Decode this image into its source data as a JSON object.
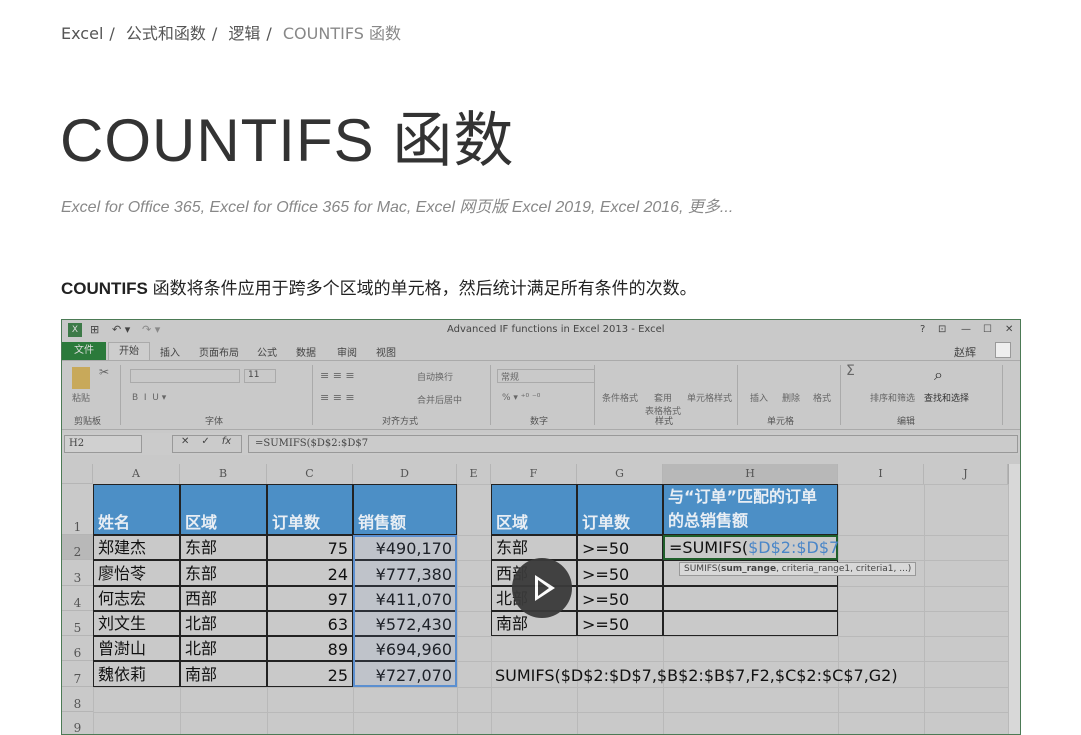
{
  "breadcrumb": [
    "Excel",
    "公式和函数",
    "逻辑",
    "COUNTIFS 函数"
  ],
  "breadcrumb_sep": "/",
  "title": "COUNTIFS 函数",
  "applies_to": "Excel for Office 365, Excel for Office 365 for Mac, Excel 网页版 Excel 2019, Excel 2016, 更多...",
  "intro": {
    "bold": "COUNTIFS",
    "text": " 函数将条件应用于跨多个区域的单元格，然后统计满足所有条件的次数。"
  },
  "excel": {
    "window_title": "Advanced IF functions in Excel 2013 - Excel",
    "window_buttons": [
      "?",
      "⊡",
      "—",
      "☐",
      "✕"
    ],
    "qat": [
      "⊞",
      "↶ ▾",
      "↷ ▾",
      "₹"
    ],
    "user": "赵辉",
    "tabs": [
      "文件",
      "开始",
      "插入",
      "页面布局",
      "公式",
      "数据",
      "审阅",
      "视图"
    ],
    "ribbon": {
      "groups": [
        "剪贴板",
        "字体",
        "对齐方式",
        "数字",
        "样式",
        "单元格",
        "编辑"
      ],
      "paste": "粘贴",
      "font_size": "11",
      "wrap_text": "自动换行",
      "merge_center": "合并后居中",
      "number_format": "常规",
      "styles": [
        "条件格式",
        "套用\n表格格式",
        "单元格样式"
      ],
      "cells": [
        "插入",
        "删除",
        "格式"
      ],
      "editing": [
        "排序和筛选",
        "查找和选择"
      ]
    },
    "name_box": "H2",
    "formula": "=SUMIFS($D$2:$D$7",
    "columns": [
      "A",
      "B",
      "C",
      "D",
      "E",
      "F",
      "G",
      "H",
      "I",
      "J"
    ],
    "rows": [
      "1",
      "2",
      "3",
      "4",
      "5",
      "6",
      "7",
      "8",
      "9"
    ],
    "table1": {
      "headers": [
        "姓名",
        "区域",
        "订单数",
        "销售额"
      ],
      "rows": [
        [
          "郑建杰",
          "东部",
          "75",
          "¥490,170"
        ],
        [
          "廖怡苓",
          "东部",
          "24",
          "¥777,380"
        ],
        [
          "何志宏",
          "西部",
          "97",
          "¥411,070"
        ],
        [
          "刘文生",
          "北部",
          "63",
          "¥572,430"
        ],
        [
          "曾澍山",
          "北部",
          "89",
          "¥694,960"
        ],
        [
          "魏依莉",
          "南部",
          "25",
          "¥727,070"
        ]
      ]
    },
    "table2": {
      "headers": [
        "区域",
        "订单数",
        "与“订单”匹配的订单的总销售额"
      ],
      "rows": [
        [
          "东部",
          ">=50"
        ],
        [
          "西部",
          ">=50"
        ],
        [
          "北部",
          ">=50"
        ],
        [
          "南部",
          ">=50"
        ]
      ]
    },
    "h2_prefix": "=SUMIFS(",
    "h2_ref": "$D$2:$D$7",
    "tooltip": {
      "fn": "SUMIFS(",
      "bold": "sum_range",
      "rest": ", criteria_range1, criteria1, ...)"
    },
    "f7_text": "SUMIFS($D$2:$D$7,$B$2:$B$7,F2,$C$2:$C$7,G2)"
  },
  "colors": {
    "header_fill": "#4c8fc6",
    "file_tab": "#2b7a3b",
    "ref_blue": "#4a86c8"
  }
}
